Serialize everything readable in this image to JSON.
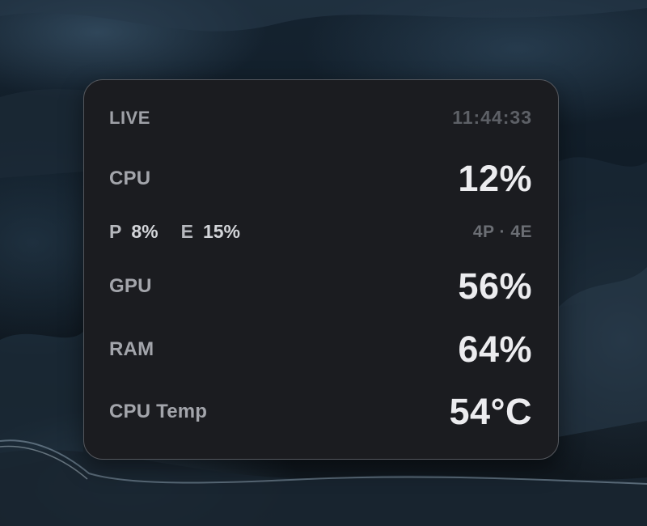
{
  "widget": {
    "live_label": "LIVE",
    "clock": "11:44:33",
    "cpu": {
      "label": "CPU",
      "value": "12%"
    },
    "cores": {
      "p_label": "P",
      "p_value": "8%",
      "e_label": "E",
      "e_value": "15%",
      "cluster": "4P · 4E"
    },
    "gpu": {
      "label": "GPU",
      "value": "56%"
    },
    "ram": {
      "label": "RAM",
      "value": "64%"
    },
    "temp": {
      "label": "CPU Temp",
      "value": "54°C"
    }
  },
  "colors": {
    "widget_background": "#1b1c20",
    "widget_border": "#55585e",
    "label_text": "#a3a5ab",
    "value_text": "#ececef",
    "muted_text": "#5d6066"
  }
}
